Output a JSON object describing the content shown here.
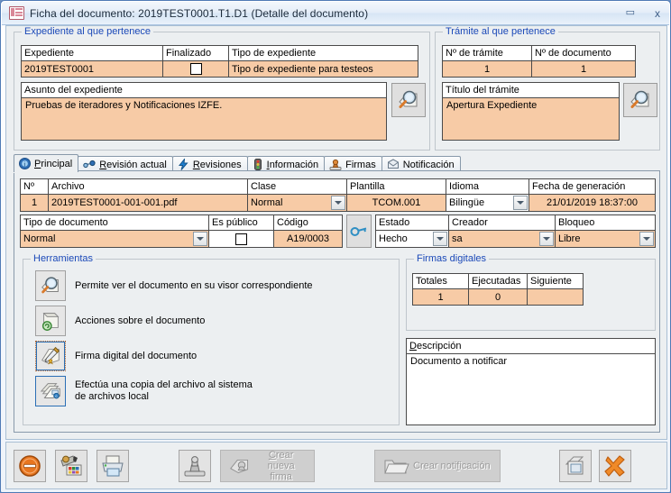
{
  "window": {
    "title": "Ficha del documento: 2019TEST0001.T1.D1 (Detalle del documento)",
    "icon": "form-icon",
    "minimize_label": "▭",
    "close_label": "x"
  },
  "expediente_group": {
    "legend": "Expediente al que pertenece",
    "headers": [
      "Expediente",
      "Finalizado",
      "Tipo de expediente"
    ],
    "values": {
      "expediente": "2019TEST0001",
      "finalizado": false,
      "tipo_de_expediente": "Tipo de expediente para testeos"
    },
    "asunto_label": "Asunto del expediente",
    "asunto_value": "Pruebas de iteradores y Notificaciones IZFE.",
    "search_button_icon": "magnifier-icon"
  },
  "tramite_group": {
    "legend": "Trámite al que pertenece",
    "headers": [
      "Nº de trámite",
      "Nº de documento"
    ],
    "values": {
      "numero_tramite": "1",
      "numero_documento": "1"
    },
    "titulo_label": "Título del trámite",
    "titulo_value": "Apertura Expediente",
    "search_button_icon": "magnifier-icon"
  },
  "tabs": [
    {
      "label": "Principal",
      "accel": "P",
      "icon": "info-globe-icon",
      "active": true
    },
    {
      "label": "Revisión actual",
      "accel": "R",
      "icon": "link-icon",
      "active": false
    },
    {
      "label": "Revisiones",
      "accel": "R",
      "icon": "lightning-icon",
      "active": false
    },
    {
      "label": "Información",
      "accel": "I",
      "icon": "traffic-light-icon",
      "active": false
    },
    {
      "label": "Firmas",
      "accel": "",
      "icon": "stamp-icon",
      "active": false
    },
    {
      "label": "Notificación",
      "accel": "",
      "icon": "envelope-icon",
      "active": false
    }
  ],
  "document_grid": {
    "headers": [
      "Nº",
      "Archivo",
      "Clase",
      "Plantilla",
      "Idioma",
      "Fecha de generación"
    ],
    "row": {
      "numero": "1",
      "archivo": "2019TEST0001-001-001.pdf",
      "clase": "Normal",
      "plantilla": "TCOM.001",
      "idioma": "Bilingüe",
      "fecha_de_generacion": "21/01/2019 18:37:00"
    }
  },
  "document_fields": {
    "left": {
      "headers": [
        "Tipo de documento",
        "Es público",
        "Código"
      ],
      "tipo_de_documento": "Normal",
      "es_publico": false,
      "codigo": "A19/0003",
      "key_button_icon": "key-icon"
    },
    "right": {
      "headers": [
        "Estado",
        "Creador",
        "Bloqueo"
      ],
      "estado": "Hecho",
      "creador": "sa",
      "bloqueo": "Libre"
    }
  },
  "herramientas": {
    "legend": "Herramientas",
    "items": [
      {
        "icon": "magnifier-doc-icon",
        "text": "Permite ver el documento en su visor correspondiente",
        "selected": false
      },
      {
        "icon": "doc-actions-icon",
        "text": "Acciones sobre el documento",
        "selected": false
      },
      {
        "icon": "signature-pen-icon",
        "text": "Firma digital del documento",
        "selected": "focus"
      },
      {
        "icon": "copy-local-icon",
        "text": "Efectúa una copia del archivo al sistema\nde archivos local",
        "selected": true
      }
    ]
  },
  "firmas_digitales": {
    "legend": "Firmas digitales",
    "headers": [
      "Totales",
      "Ejecutadas",
      "Siguiente"
    ],
    "values": {
      "totales": "1",
      "ejecutadas": "0",
      "siguiente": ""
    }
  },
  "descripcion": {
    "label": "Descripción",
    "accel": "e",
    "value": "Documento a notificar"
  },
  "bottom_toolbar": {
    "buttons": [
      {
        "name": "close-button",
        "icon": "forbidden-icon",
        "label": "",
        "disabled": false
      },
      {
        "name": "edit-button",
        "icon": "pencil-palette-icon",
        "label": "",
        "disabled": false
      },
      {
        "name": "print-button",
        "icon": "printer-icon",
        "label": "",
        "disabled": false
      },
      {
        "name": "stamp-button",
        "icon": "stamp-icon",
        "label": "",
        "disabled": false
      },
      {
        "name": "create-new-signature-button",
        "icon": "new-signature-icon",
        "label": "Crear nueva firma",
        "accel": "C",
        "disabled": true
      },
      {
        "name": "create-notification-button",
        "icon": "folder-icon",
        "label": "Crear notificación",
        "accel": "f",
        "disabled": true
      },
      {
        "name": "documents-button",
        "icon": "documents-icon",
        "label": "",
        "disabled": false
      },
      {
        "name": "exit-button",
        "icon": "orange-x-icon",
        "label": "",
        "disabled": false
      }
    ]
  },
  "colors": {
    "field_fill": "#f7cba6",
    "legend_text": "#1b49b8",
    "window_border": "#4f7ab5",
    "client_bg": "#eceff1"
  }
}
